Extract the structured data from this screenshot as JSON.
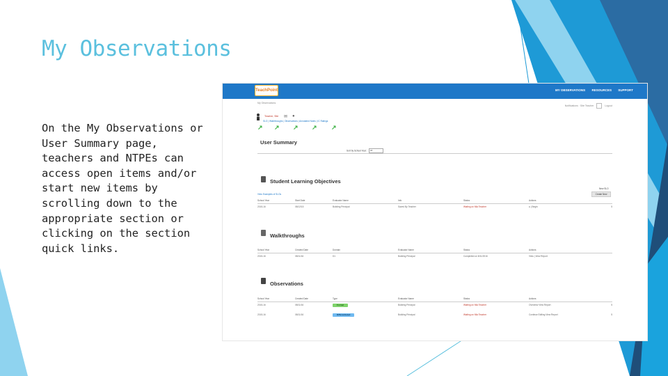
{
  "slide": {
    "title": "My Observations",
    "body": "On the My Observations or User Summary page, teachers and NTPEs can access open items and/or start new items by scrolling down to the appropriate section or clicking on the section quick links.",
    "accent_colors": [
      "#1f4e79",
      "#2b6ca3",
      "#1e9ad6",
      "#5bc0de",
      "#8fd3ef"
    ]
  },
  "app": {
    "logo_text": "TeachPoint",
    "nav": [
      "MY OBSERVATIONS",
      "RESOURCES",
      "SUPPORT"
    ],
    "breadcrumb": "My Observations",
    "account_text": "Notifications · Site Teacher",
    "logout": "Logout",
    "user_name": "Teacher, Site",
    "quick_links": "SLO  |  Walkthroughs  |  Observations  |  Annotated Notes  |  IC Ratings",
    "user_summary": {
      "heading": "User Summary",
      "sort_label": "Sort by School Year:",
      "sort_value": "All"
    },
    "slo": {
      "heading": "Student Learning Objectives",
      "view_link": "View Examples of SLOs",
      "new_label": "New SLO",
      "create_button": "Create New",
      "columns": [
        "School Year",
        "Start Date",
        "Evaluator Name",
        "Info",
        "Status",
        "Actions"
      ],
      "rows": [
        {
          "year": "2015-16",
          "date": "08/12/15",
          "evaluator": "Building Principal",
          "info": "Saved By Teacher",
          "status": "Waiting on Mia Teacher",
          "actions": "| Begin",
          "num": "5"
        }
      ]
    },
    "walkthroughs": {
      "heading": "Walkthroughs",
      "columns": [
        "School Year",
        "Created Date",
        "Domain",
        "Evaluator Name",
        "Status",
        "Actions"
      ],
      "rows": [
        {
          "year": "2015-16",
          "date": "08/11/16",
          "domain": "D1",
          "evaluator": "Building Principal",
          "status": "Completed on 8/11/2016",
          "actions": "View | View Report"
        }
      ]
    },
    "observations": {
      "heading": "Observations",
      "columns": [
        "School Year",
        "Created Date",
        "Type",
        "Evaluator Name",
        "Status",
        "Actions"
      ],
      "rows": [
        {
          "year": "2015-16",
          "date": "08/11/16",
          "type": "Formal",
          "evaluator": "Building Principal",
          "status": "Waiting on Mia Teacher",
          "actions": "Overview  View Report",
          "num": "5"
        },
        {
          "year": "2015-16",
          "date": "08/11/16",
          "type": "Differentiated",
          "evaluator": "Building Principal",
          "status": "Waiting on Mia Teacher",
          "actions": "Continue Editing  View Report",
          "num": "5"
        }
      ]
    }
  }
}
